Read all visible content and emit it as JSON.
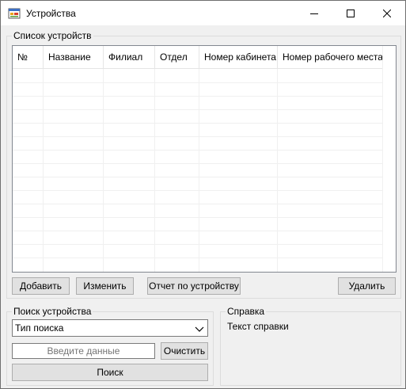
{
  "window": {
    "title": "Устройства",
    "icon": "app-form-icon",
    "controls": [
      "minimize-icon",
      "maximize-icon",
      "close-icon"
    ]
  },
  "devices_group": {
    "caption": "Список устройств",
    "table": {
      "columns": [
        "№",
        "Название",
        "Филиал",
        "Отдел",
        "Номер кабинета",
        "Номер рабочего места"
      ],
      "rows": []
    },
    "buttons": {
      "add": "Добавить",
      "edit": "Изменить",
      "report": "Отчет по устройству",
      "delete": "Удалить"
    }
  },
  "search_group": {
    "caption": "Поиск устройства",
    "search_type": {
      "selected": "Тип поиска"
    },
    "input": {
      "value": "",
      "placeholder": "Введите данные"
    },
    "clear_label": "Очистить",
    "search_label": "Поиск"
  },
  "help_group": {
    "caption": "Справка",
    "text": "Текст справки"
  }
}
